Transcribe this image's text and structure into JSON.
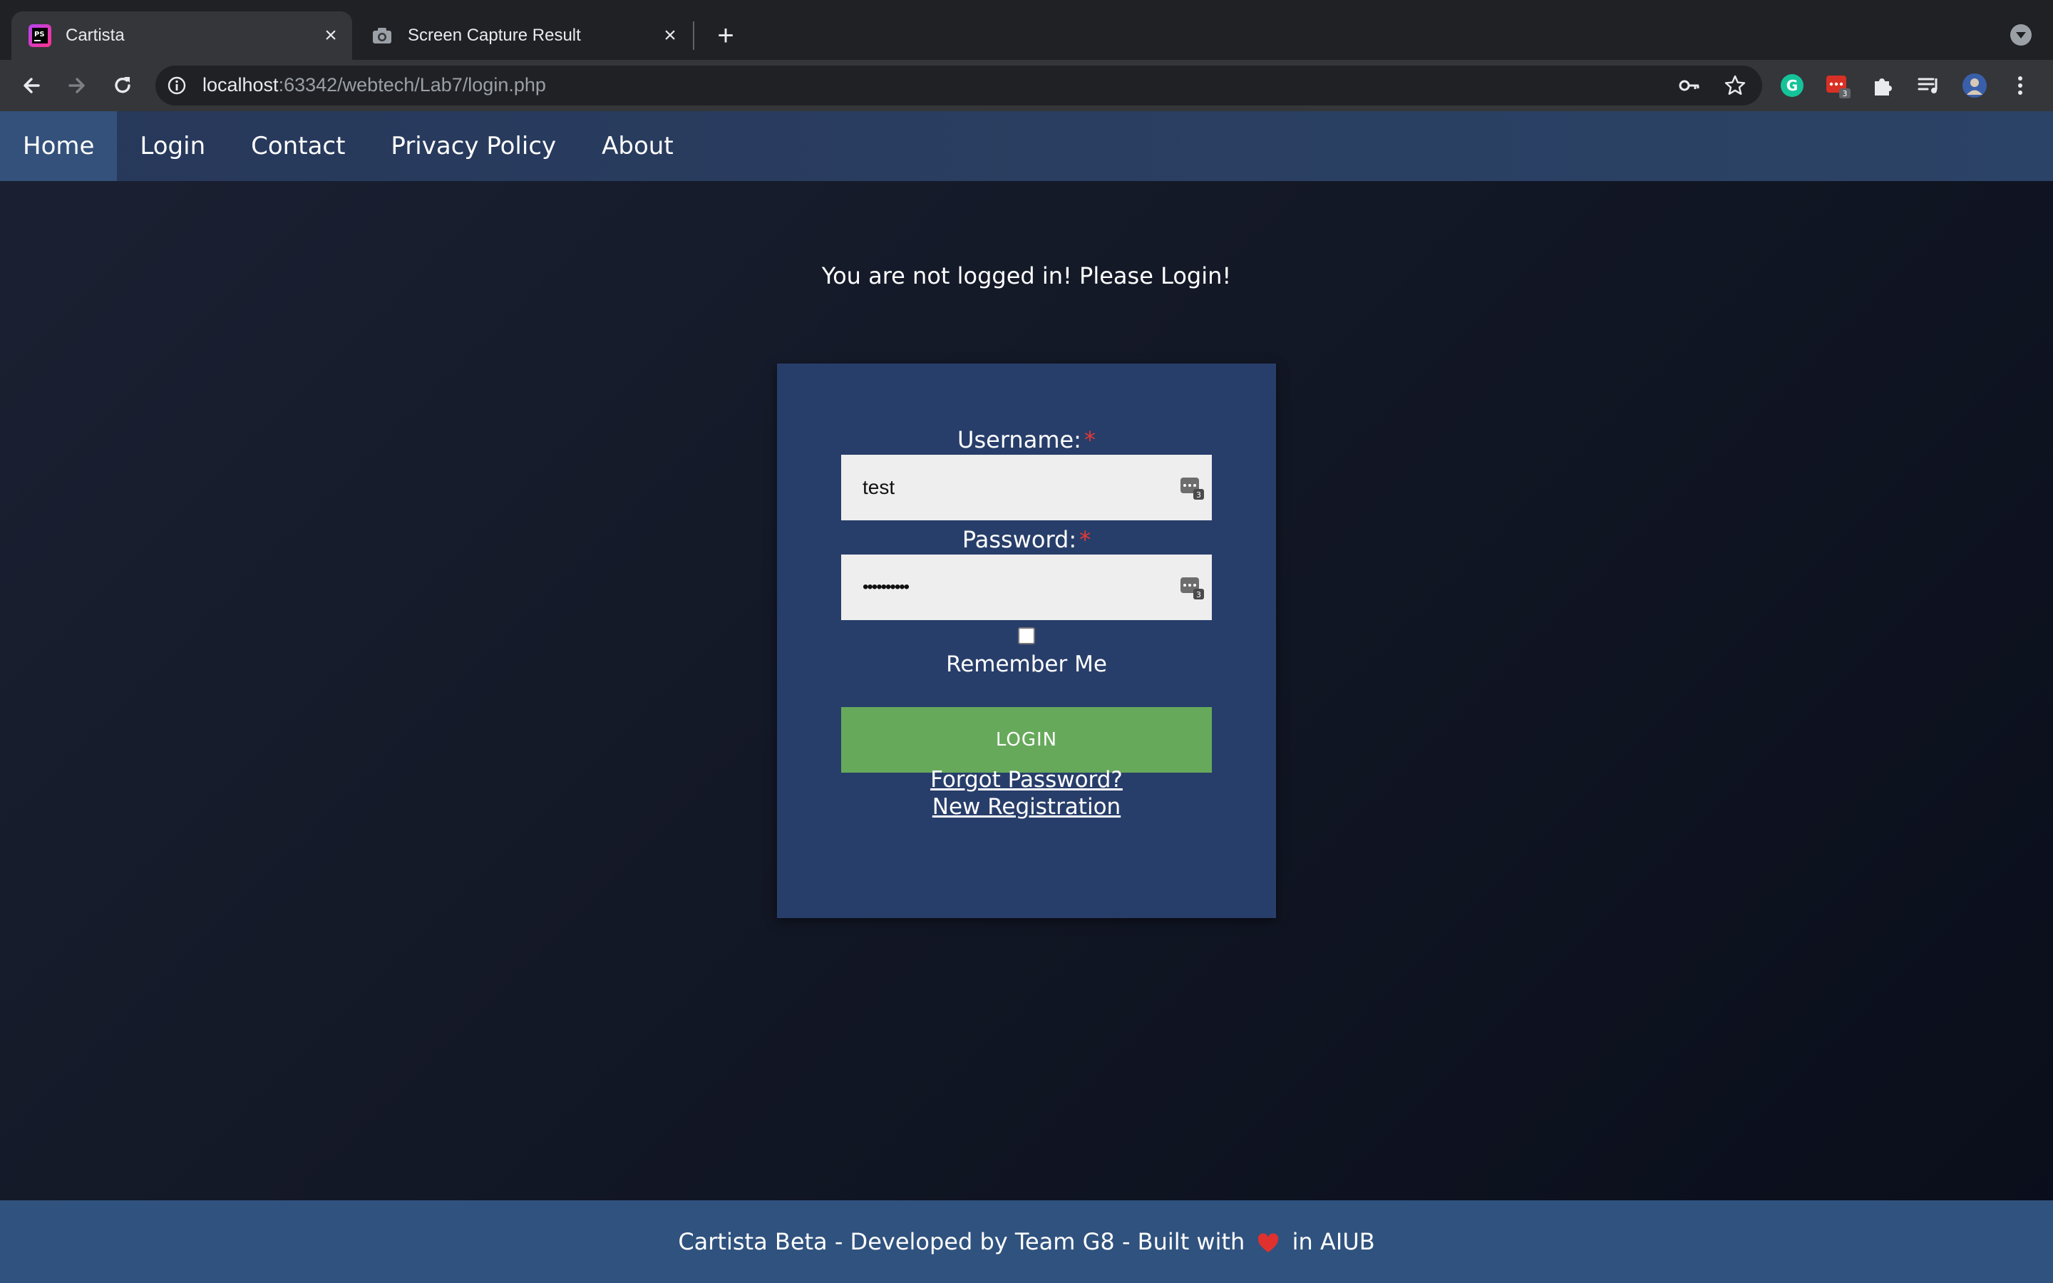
{
  "browser": {
    "tabs": [
      {
        "title": "Cartista",
        "favicon": "phpstorm-icon",
        "active": true
      },
      {
        "title": "Screen Capture Result",
        "favicon": "camera-icon",
        "active": false
      }
    ],
    "new_tab_label": "+",
    "close_label": "×",
    "url_host": "localhost",
    "url_path": ":63342/webtech/Lab7/login.php",
    "extension_badge": "3"
  },
  "site": {
    "nav": [
      {
        "label": "Home",
        "active": true
      },
      {
        "label": "Login",
        "active": false
      },
      {
        "label": "Contact",
        "active": false
      },
      {
        "label": "Privacy Policy",
        "active": false
      },
      {
        "label": "About",
        "active": false
      }
    ],
    "notice": "You are not logged in! Please Login!",
    "form": {
      "username_label": "Username:",
      "username_value": "test",
      "password_label": "Password:",
      "password_value": "••••••••••",
      "required_mark": "*",
      "remember_label": "Remember Me",
      "remember_checked": false,
      "submit_label": "LOGIN",
      "forgot_link": "Forgot Password?",
      "register_link": "New Registration",
      "pm_badge": "3"
    },
    "footer": {
      "text_before": "Cartista Beta - Developed by Team G8 - Built with",
      "text_after": "in AIUB"
    }
  },
  "colors": {
    "nav_bg": "#2a3f62",
    "card_bg": "#283e6a",
    "button_green": "#67a95b",
    "footer_bg": "#30527e",
    "required_red": "#e53935"
  }
}
